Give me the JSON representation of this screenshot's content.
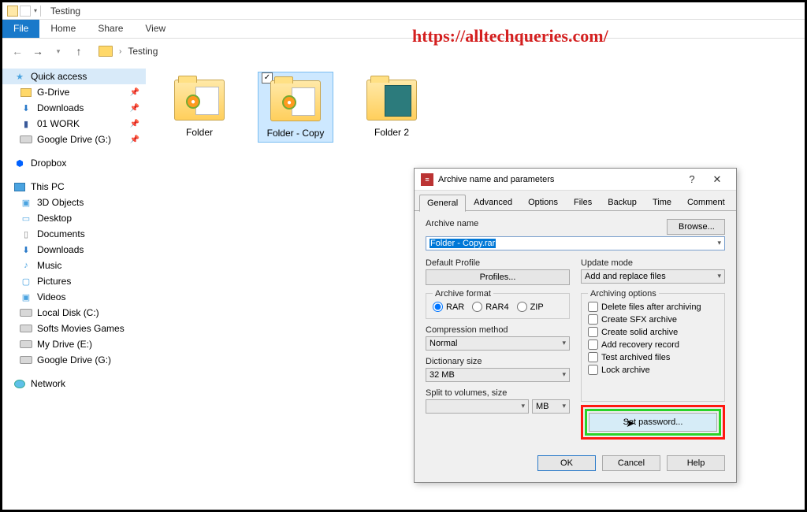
{
  "window": {
    "title": "Testing"
  },
  "ribbon": {
    "file": "File",
    "home": "Home",
    "share": "Share",
    "view": "View"
  },
  "breadcrumb": {
    "current": "Testing"
  },
  "watermark": "https://alltechqueries.com/",
  "sidebar": {
    "quick_access": "Quick access",
    "items_qa": [
      {
        "label": "G-Drive"
      },
      {
        "label": "Downloads"
      },
      {
        "label": "01 WORK"
      },
      {
        "label": "Google Drive (G:)"
      }
    ],
    "dropbox": "Dropbox",
    "this_pc": "This PC",
    "items_pc": [
      {
        "label": "3D Objects"
      },
      {
        "label": "Desktop"
      },
      {
        "label": "Documents"
      },
      {
        "label": "Downloads"
      },
      {
        "label": "Music"
      },
      {
        "label": "Pictures"
      },
      {
        "label": "Videos"
      },
      {
        "label": "Local Disk (C:)"
      },
      {
        "label": "Softs Movies Games"
      },
      {
        "label": "My Drive (E:)"
      },
      {
        "label": "Google Drive (G:)"
      }
    ],
    "network": "Network"
  },
  "files": [
    {
      "name": "Folder"
    },
    {
      "name": "Folder - Copy"
    },
    {
      "name": "Folder 2"
    }
  ],
  "dialog": {
    "title": "Archive name and parameters",
    "help": "?",
    "tabs": [
      "General",
      "Advanced",
      "Options",
      "Files",
      "Backup",
      "Time",
      "Comment"
    ],
    "archive_name_lbl": "Archive name",
    "archive_name_val": "Folder - Copy.rar",
    "browse": "Browse...",
    "default_profile_lbl": "Default Profile",
    "profiles_btn": "Profiles...",
    "update_mode_lbl": "Update mode",
    "update_mode_val": "Add and replace files",
    "format_legend": "Archive format",
    "formats": [
      "RAR",
      "RAR4",
      "ZIP"
    ],
    "compression_lbl": "Compression method",
    "compression_val": "Normal",
    "dict_lbl": "Dictionary size",
    "dict_val": "32 MB",
    "split_lbl": "Split to volumes, size",
    "split_unit": "MB",
    "opts_legend": "Archiving options",
    "opts": [
      "Delete files after archiving",
      "Create SFX archive",
      "Create solid archive",
      "Add recovery record",
      "Test archived files",
      "Lock archive"
    ],
    "set_password": "Set password...",
    "ok": "OK",
    "cancel": "Cancel",
    "help_btn": "Help"
  }
}
